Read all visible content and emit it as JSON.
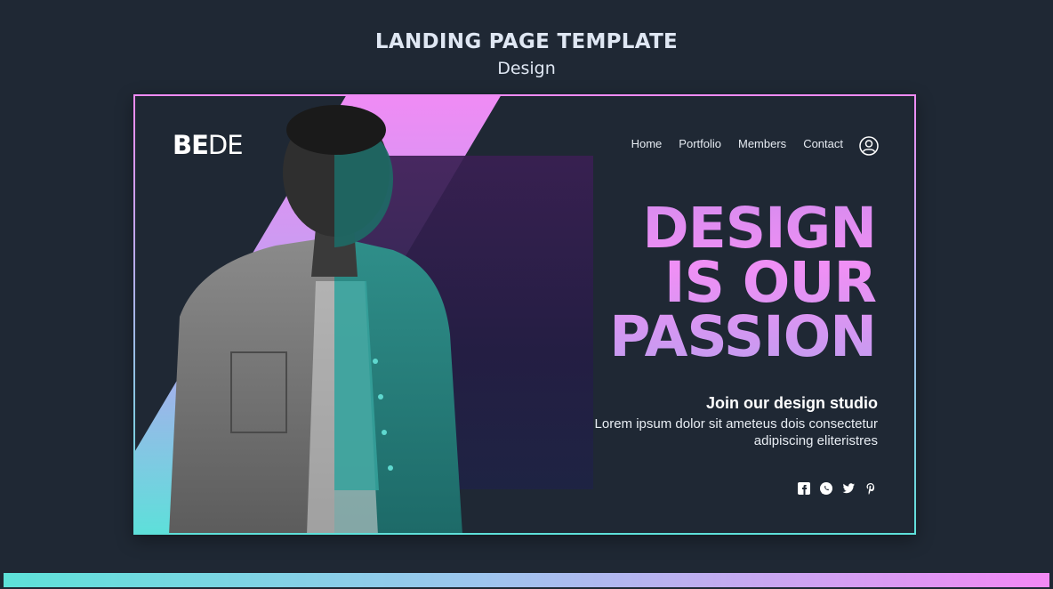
{
  "header": {
    "title": "LANDING PAGE TEMPLATE",
    "subtitle": "Design"
  },
  "card": {
    "logo": {
      "bold": "BE",
      "light": "DE"
    },
    "nav": [
      "Home",
      "Portfolio",
      "Members",
      "Contact"
    ],
    "headline": [
      "DESIGN",
      "IS OUR",
      "PASSION"
    ],
    "join_title": "Join our design studio",
    "description": "Lorem ipsum dolor sit ameteus dois consectetur adipiscing eliteristres",
    "social_icons": [
      "facebook-icon",
      "whatsapp-icon",
      "twitter-icon",
      "pinterest-icon"
    ]
  },
  "colors": {
    "background": "#1f2834",
    "accent_pink": "#f08bf5",
    "accent_cyan": "#5ee0da",
    "overlay": "#2a1e4b"
  }
}
